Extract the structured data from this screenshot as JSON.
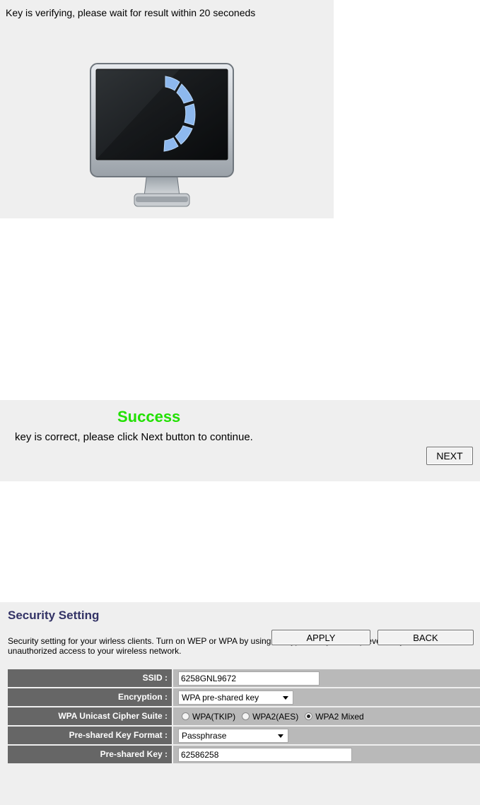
{
  "verify": {
    "message": "Key is verifying, please wait for result within 20 seconeds",
    "icon": "monitor-loading-icon"
  },
  "success": {
    "title": "Success",
    "message": "key is correct, please click Next button to continue.",
    "next_label": "NEXT",
    "title_color": "#21e000"
  },
  "security": {
    "title": "Security Setting",
    "title_color": "#333366",
    "description_line1": "Security setting for your wirless clients. Turn on WEP or WPA by using Encryption Keys could prevent any",
    "description_line2": "unauthorized access to your wireless network.",
    "fields": {
      "ssid_label": "SSID :",
      "ssid_value": "6258GNL9672",
      "encryption_label": "Encryption :",
      "encryption_value": "WPA pre-shared key",
      "cipher_label": "WPA Unicast Cipher Suite :",
      "cipher_options": [
        "WPA(TKIP)",
        "WPA2(AES)",
        "WPA2 Mixed"
      ],
      "cipher_selected": "WPA2 Mixed",
      "key_format_label": "Pre-shared Key Format :",
      "key_format_value": "Passphrase",
      "key_label": "Pre-shared Key :",
      "key_value": "62586258"
    },
    "apply_label": "APPLY",
    "back_label": "BACK"
  }
}
